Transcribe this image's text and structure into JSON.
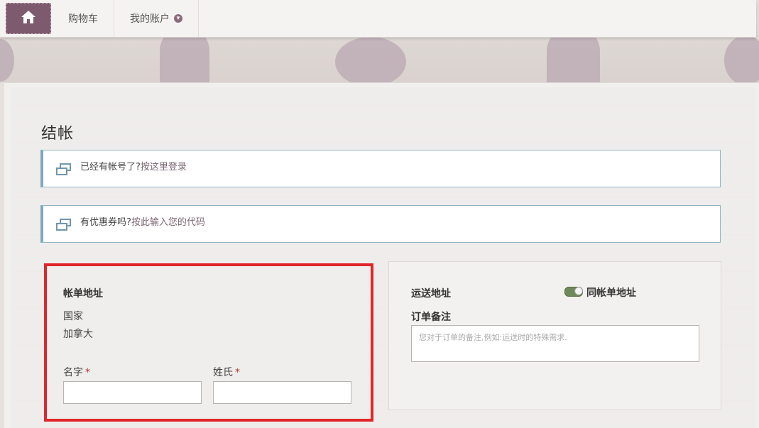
{
  "nav": {
    "items": [
      {
        "label": "购物车"
      },
      {
        "label": "我的账户"
      }
    ]
  },
  "colors": {
    "brand": "#7d5a6d",
    "notice_border": "#7eaabf",
    "highlight": "#e0262b",
    "toggle_on": "#6f8a5a"
  },
  "page": {
    "title": "结帐"
  },
  "notices": [
    {
      "text": "已经有帐号了?",
      "link": "按这里登录"
    },
    {
      "text": "有优惠券吗?",
      "link": "按此输入您的代码"
    }
  ],
  "billing": {
    "title": "帐单地址",
    "country_label": "国家",
    "country_value": "加拿大",
    "first_name_label": "名字",
    "last_name_label": "姓氏",
    "required_mark": "*"
  },
  "shipping": {
    "title": "运送地址",
    "same_as_billing_label": "同帐单地址",
    "same_as_billing_checked": true,
    "notes_label": "订单备注",
    "notes_placeholder": "您对于订单的备注,例如:运送时的特殊需求."
  }
}
